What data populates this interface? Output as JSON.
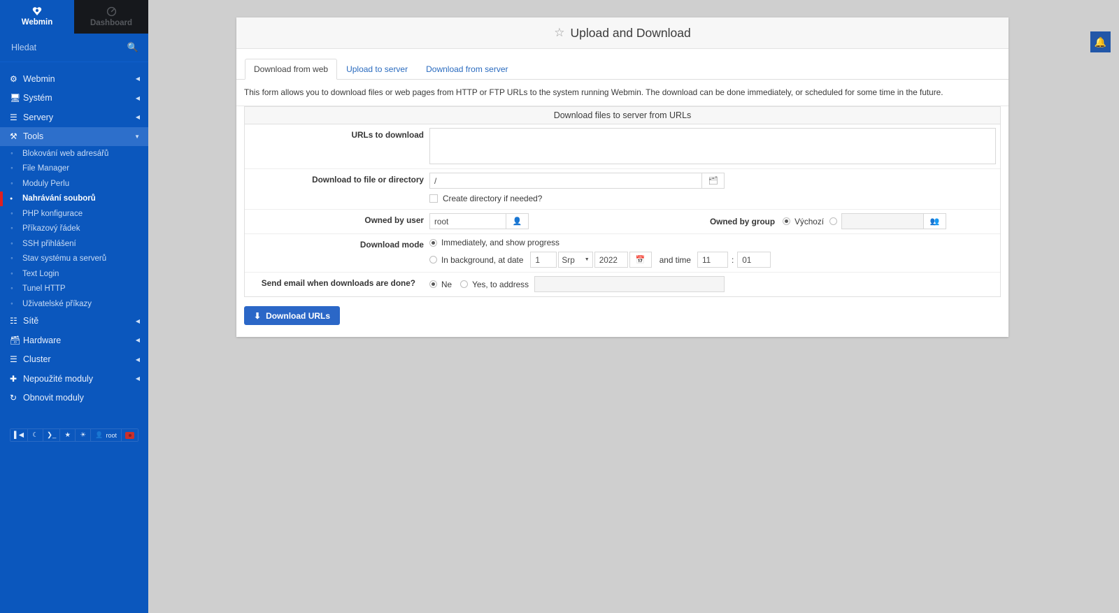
{
  "sidebar": {
    "tabs": [
      {
        "label": "Webmin",
        "icon": "webmin-logo-icon",
        "active": true
      },
      {
        "label": "Dashboard",
        "icon": "dashboard-gauge-icon",
        "active": false
      }
    ],
    "search": {
      "placeholder": "Hledat",
      "value": "",
      "icon": "search-icon"
    },
    "nav": [
      {
        "label": "Webmin",
        "icon": "gear-icon",
        "caret": "left"
      },
      {
        "label": "Systém",
        "icon": "monitor-icon",
        "caret": "left"
      },
      {
        "label": "Servery",
        "icon": "server-icon",
        "caret": "left"
      },
      {
        "label": "Tools",
        "icon": "tools-icon",
        "caret": "down",
        "open": true
      }
    ],
    "tools_children": [
      {
        "label": "Blokování web adresářů"
      },
      {
        "label": "File Manager"
      },
      {
        "label": "Moduly Perlu"
      },
      {
        "label": "Nahrávání souborů",
        "current": true
      },
      {
        "label": "PHP konfigurace"
      },
      {
        "label": "Příkazový řádek"
      },
      {
        "label": "SSH přihlášení"
      },
      {
        "label": "Stav systému a serverů"
      },
      {
        "label": "Text Login"
      },
      {
        "label": "Tunel HTTP"
      },
      {
        "label": "Uživatelské příkazy"
      }
    ],
    "nav_after": [
      {
        "label": "Sítě",
        "icon": "network-icon",
        "caret": "left"
      },
      {
        "label": "Hardware",
        "icon": "hardware-icon",
        "caret": "left"
      },
      {
        "label": "Cluster",
        "icon": "layers-icon",
        "caret": "left"
      },
      {
        "label": "Nepoužité moduly",
        "icon": "puzzle-icon",
        "caret": "left"
      },
      {
        "label": "Obnovit moduly",
        "icon": "refresh-icon",
        "caret": "none"
      }
    ],
    "toolbar": [
      {
        "name": "collapse-sidebar-icon",
        "glyph": "❙◀"
      },
      {
        "name": "dark-mode-icon",
        "glyph": "☾"
      },
      {
        "name": "terminal-icon",
        "glyph": "❯_"
      },
      {
        "name": "favorites-star-icon",
        "glyph": "★"
      },
      {
        "name": "theme-palette-icon",
        "glyph": "◕"
      }
    ],
    "user": {
      "label": "root",
      "icon": "user-icon"
    },
    "logout": {
      "name": "logout-button",
      "color": "#c9302c"
    }
  },
  "notifications": {
    "icon": "bell-icon",
    "name": "notifications-button"
  },
  "page": {
    "title": "Upload and Download",
    "favorite_icon": "star-outline-icon",
    "tabs": [
      {
        "label": "Download from web",
        "active": true
      },
      {
        "label": "Upload to server",
        "active": false
      },
      {
        "label": "Download from server",
        "active": false
      }
    ],
    "intro": "This form allows you to download files or web pages from HTTP or FTP URLs to the system running Webmin. The download can be done immediately, or scheduled for some time in the future.",
    "panel_title": "Download files to server from URLs",
    "fields": {
      "urls": {
        "label": "URLs to download",
        "value": ""
      },
      "destination": {
        "label": "Download to file or directory",
        "value": "/",
        "browse_icon": "file-chooser-icon"
      },
      "create_dir": {
        "label": "Create directory if needed?",
        "checked": false
      },
      "owned_by_user": {
        "label": "Owned by user",
        "value": "root",
        "picker_icon": "user-chooser-icon"
      },
      "owned_by_group": {
        "label": "Owned by group",
        "default_option": "Výchozí",
        "default_selected": true,
        "custom_value": "",
        "picker_icon": "group-chooser-icon"
      },
      "download_mode": {
        "label": "Download mode",
        "option_immediate": "Immediately, and show progress",
        "option_background": "In background, at date",
        "selected": "immediate",
        "date_day": "1",
        "date_month": "Srp",
        "date_year": "2022",
        "calendar_icon": "calendar-icon",
        "time_label": "and time",
        "time_hour": "11",
        "time_sep": ":",
        "time_minute": "01"
      },
      "send_email": {
        "label": "Send email when downloads are done?",
        "option_no": "Ne",
        "option_yes": "Yes, to address",
        "selected": "no",
        "address": ""
      }
    },
    "submit": {
      "label": "Download URLs",
      "icon": "download-icon",
      "color": "#2b67c7"
    }
  }
}
